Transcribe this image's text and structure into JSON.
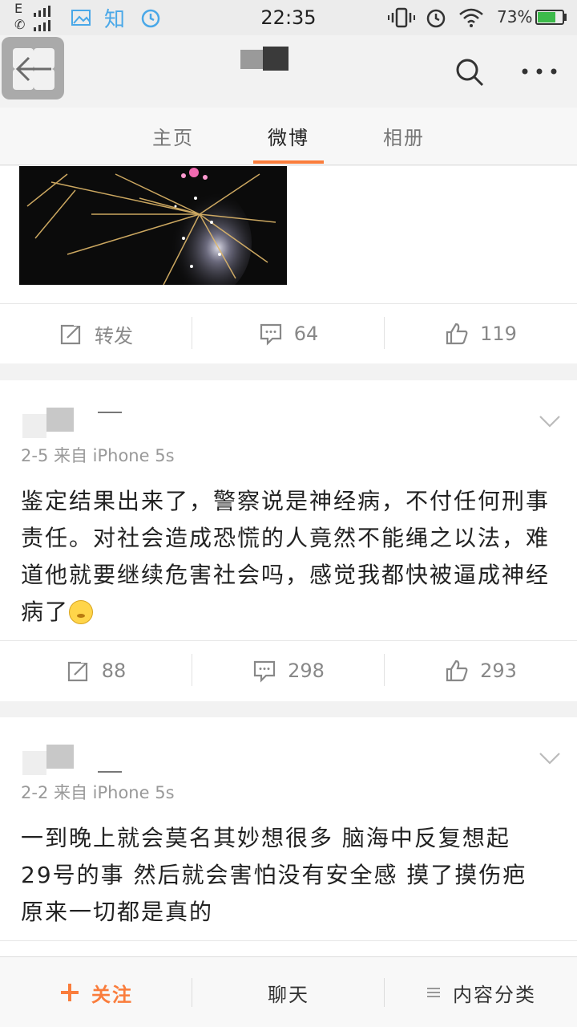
{
  "status_bar": {
    "network": "E",
    "time": "22:35",
    "battery": "73%",
    "battery_level": 0.73,
    "left_icons": [
      "image-icon",
      "zhihu-icon",
      "alarm-icon"
    ],
    "zhihu_label": "知",
    "right_icons": [
      "vibrate-icon",
      "alarm-icon",
      "wifi-icon",
      "battery-icon"
    ]
  },
  "tabs": [
    {
      "label": "主页",
      "active": false
    },
    {
      "label": "微博",
      "active": true
    },
    {
      "label": "相册",
      "active": false
    }
  ],
  "accent_color": "#fa7d3c",
  "post_1": {
    "actions": {
      "repost": "转发",
      "comments": "64",
      "likes": "119"
    }
  },
  "post_2": {
    "meta": "2-5  来自 iPhone 5s",
    "text": "鉴定结果出来了，警察说是神经病，不付任何刑事责任。对社会造成恐慌的人竟然不能绳之以法，难道他就要继续危害社会吗，感觉我都快被逼成神经病了",
    "emoji": "thinking-emoji",
    "actions": {
      "repost": "88",
      "comments": "298",
      "likes": "293"
    }
  },
  "post_3": {
    "meta": "2-2  来自 iPhone 5s",
    "text": "一到晚上就会莫名其妙想很多 脑海中反复想起29号的事 然后就会害怕没有安全感 摸了摸伤疤 原来一切都是真的"
  },
  "bottom_bar": {
    "follow": "关注",
    "chat": "聊天",
    "categories": "内容分类"
  }
}
